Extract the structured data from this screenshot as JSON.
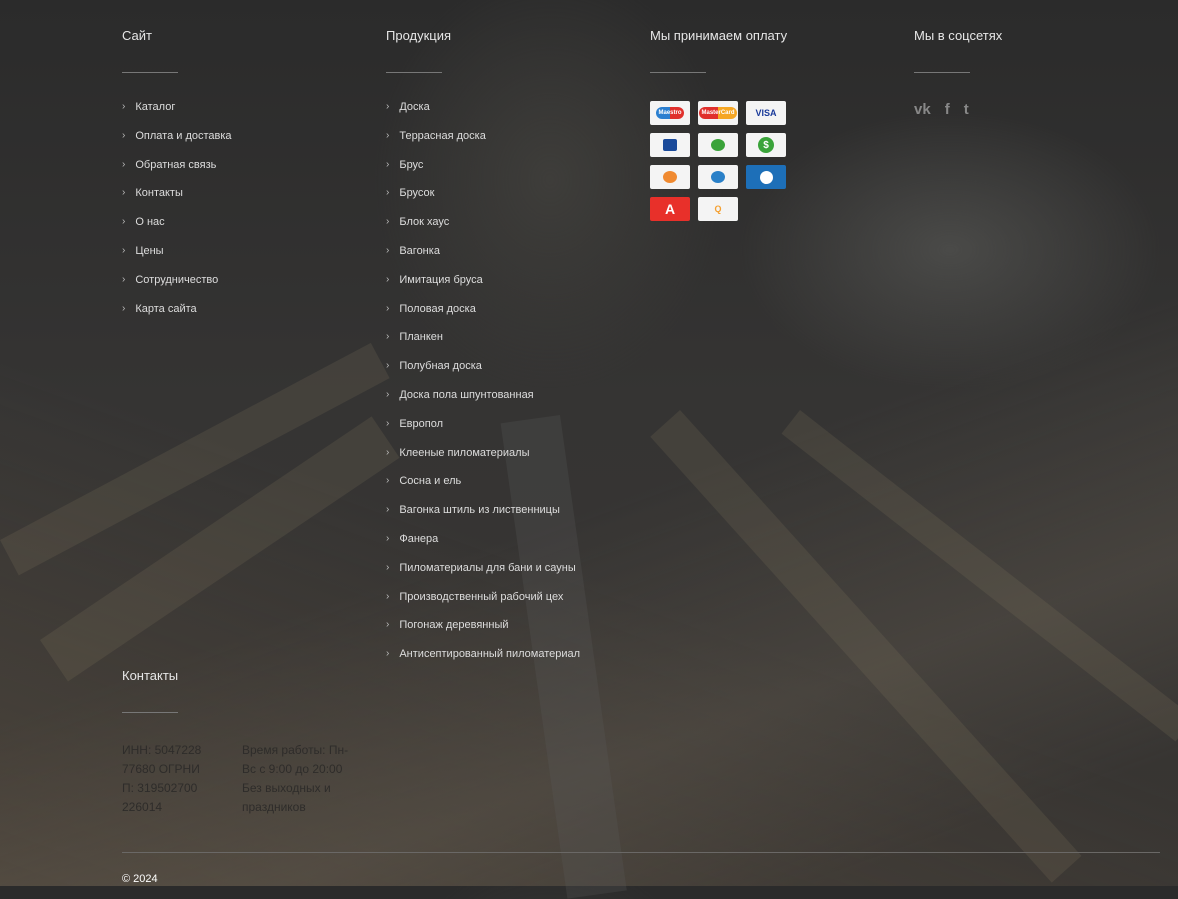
{
  "site": {
    "title": "Сайт",
    "items": [
      "Каталог",
      "Оплата и доставка",
      "Обратная связь",
      "Контакты",
      "О нас",
      "Цены",
      "Сотрудничество",
      "Карта сайта"
    ]
  },
  "products": {
    "title": "Продукция",
    "items": [
      "Доска",
      "Террасная доска",
      "Брус",
      "Брусок",
      "Блок хаус",
      "Вагонка",
      "Имитация бруса",
      "Половая доска",
      "Планкен",
      "Полубная доска",
      "Доска пола шпунтованная",
      "Европол",
      "Клееные пиломатериалы",
      "Сосна и ель",
      "Вагонка штиль из лиственницы",
      "Фанера",
      "Пиломатериалы для бани и сауны",
      "Производственный рабочий цех",
      "Погонаж деревянный",
      "Антисептированный пиломатериал"
    ]
  },
  "payment": {
    "title": "Мы принимаем оплату",
    "methods": [
      {
        "name": "maestro-icon",
        "label": "Maestro",
        "color": "#2b7fd0"
      },
      {
        "name": "mastercard-icon",
        "label": "MasterCard",
        "color": "#e0302c"
      },
      {
        "name": "visa-icon",
        "label": "VISA",
        "color": "#1a3a9a"
      },
      {
        "name": "vtb-icon",
        "label": "",
        "color": "#1a4a9a"
      },
      {
        "name": "sberbank-icon",
        "label": "",
        "color": "#3aa33a"
      },
      {
        "name": "dollar-icon",
        "label": "$",
        "color": "#3aa33a"
      },
      {
        "name": "yandex-money-icon",
        "label": "",
        "color": "#f08a30"
      },
      {
        "name": "webmoney-icon",
        "label": "",
        "color": "#2a80c8"
      },
      {
        "name": "webmoney-blue-icon",
        "label": "",
        "color": "#1d6fb8"
      },
      {
        "name": "alfabank-icon",
        "label": "А",
        "color": "#e8302a"
      },
      {
        "name": "qiwi-icon",
        "label": "Q",
        "color": "#f5a030"
      }
    ]
  },
  "social": {
    "title": "Мы в соцсетях",
    "icons": [
      {
        "name": "vk-icon",
        "glyph": "vk"
      },
      {
        "name": "facebook-icon",
        "glyph": "f"
      },
      {
        "name": "twitter-icon",
        "glyph": "t"
      }
    ]
  },
  "contacts": {
    "title": "Контакты",
    "left": "ИНН: 504722877680 ОГРНИП: 319502700226014",
    "right": "Время работы: Пн-Вс с 9:00 до 20:00 Без выходных и праздников"
  },
  "copyright": "© 2024"
}
